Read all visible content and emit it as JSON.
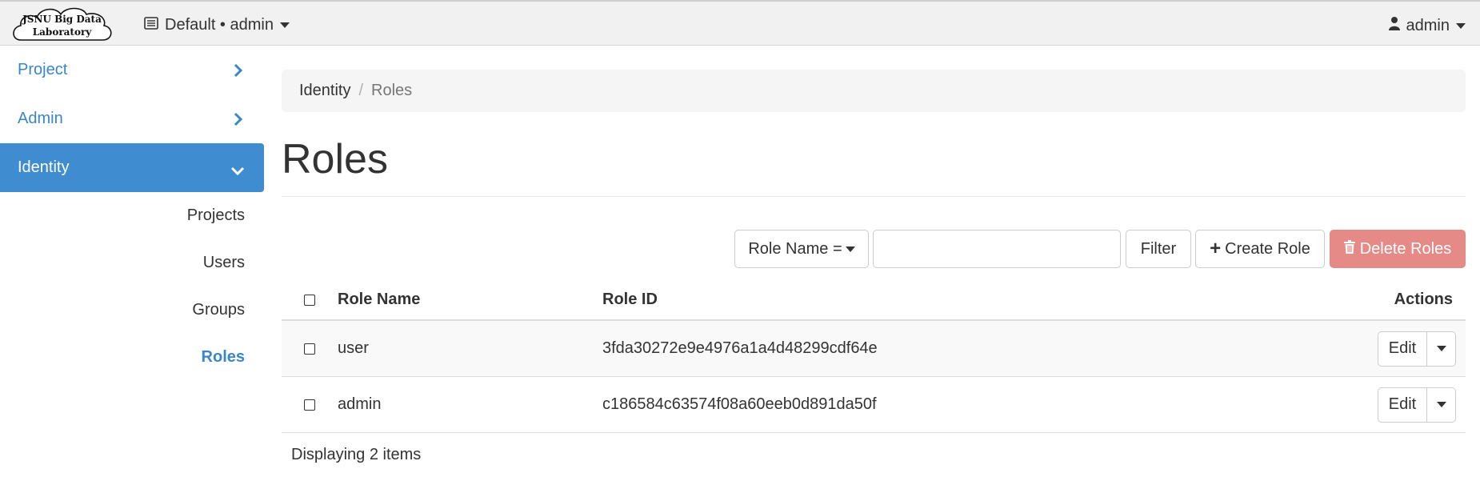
{
  "topbar": {
    "logo_line1": "JSNU Big Data",
    "logo_line2": "Laboratory",
    "project_switcher": "Default • admin",
    "user_menu": "admin"
  },
  "sidebar": {
    "dashboards": [
      {
        "label": "Project"
      },
      {
        "label": "Admin"
      },
      {
        "label": "Identity"
      }
    ],
    "identity_items": [
      {
        "label": "Projects"
      },
      {
        "label": "Users"
      },
      {
        "label": "Groups"
      },
      {
        "label": "Roles"
      }
    ]
  },
  "breadcrumb": {
    "parent": "Identity",
    "separator": "/",
    "current": "Roles"
  },
  "page_title": "Roles",
  "toolbar": {
    "filter_field": "Role Name =",
    "filter_value": "",
    "filter_button": "Filter",
    "create_button": "Create Role",
    "delete_button": "Delete Roles"
  },
  "table": {
    "columns": [
      "Role Name",
      "Role ID",
      "Actions"
    ],
    "rows": [
      {
        "name": "user",
        "id": "3fda30272e9e4976a1a4d48299cdf64e",
        "action": "Edit"
      },
      {
        "name": "admin",
        "id": "c186584c63574f08a60eeb0d891da50f",
        "action": "Edit"
      }
    ],
    "footer": "Displaying 2 items"
  },
  "colors": {
    "accent": "#3f8dd0",
    "link": "#3a87c8",
    "danger": "#e68a88"
  }
}
